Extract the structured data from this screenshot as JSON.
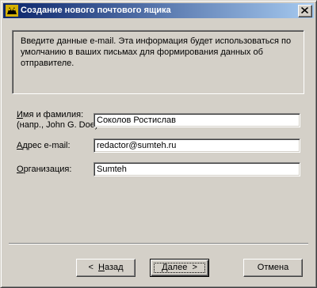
{
  "window": {
    "title": "Создание нового почтового ящика",
    "app_icon": "mail-app-icon",
    "close_icon": "close-icon"
  },
  "info": {
    "text": "Введите данные e-mail. Эта информация будет использоваться по умолчанию в ваших письмах для формирования данных об отправителе."
  },
  "form": {
    "name": {
      "label_line1_mnemonic": "И",
      "label_line1_rest": "мя и фамилия:",
      "label_line2": "(напр., John G. Doe)",
      "value": "Соколов Ростислав"
    },
    "email": {
      "label_mnemonic": "А",
      "label_rest": "дрес e-mail:",
      "value": "redactor@sumteh.ru"
    },
    "org": {
      "label_mnemonic": "О",
      "label_rest": "рганизация:",
      "value": "Sumteh"
    }
  },
  "buttons": {
    "back": {
      "prefix": "<  ",
      "mnemonic": "Н",
      "rest": "азад"
    },
    "next": {
      "mnemonic": "Д",
      "rest": "алее",
      "suffix": "  >"
    },
    "cancel": {
      "label": "Отмена"
    }
  }
}
